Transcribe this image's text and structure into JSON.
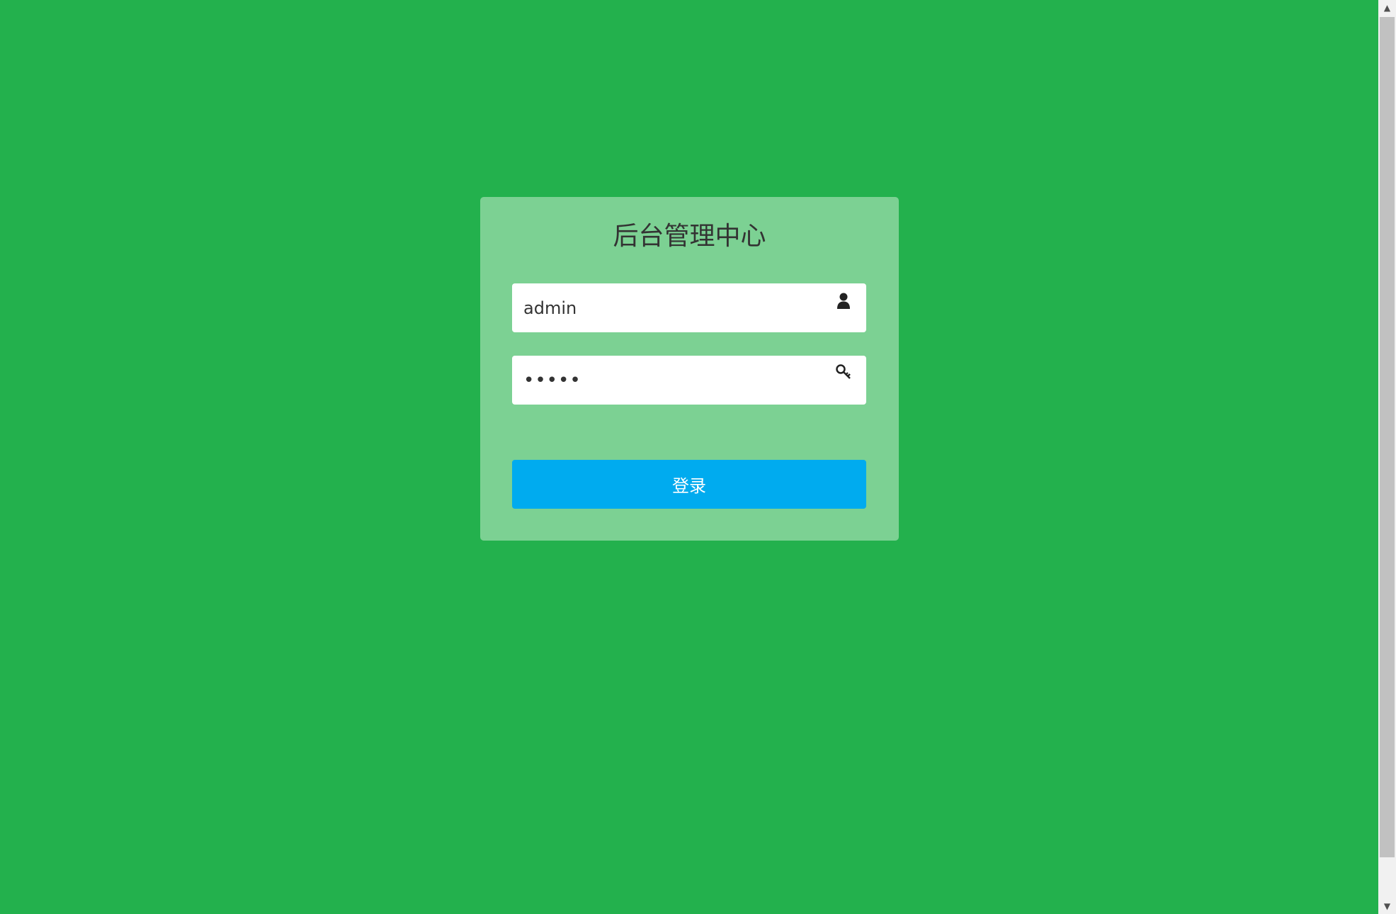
{
  "page": {
    "background_color": "#23b14d"
  },
  "login": {
    "title": "后台管理中心",
    "card_color": "#7cd193",
    "username": {
      "value": "admin",
      "icon": "user-icon"
    },
    "password": {
      "value": "•••••",
      "icon": "key-icon"
    },
    "submit_label": "登录",
    "submit_color": "#00abef"
  },
  "scrollbar": {
    "up_arrow": "▲",
    "down_arrow": "▼"
  }
}
